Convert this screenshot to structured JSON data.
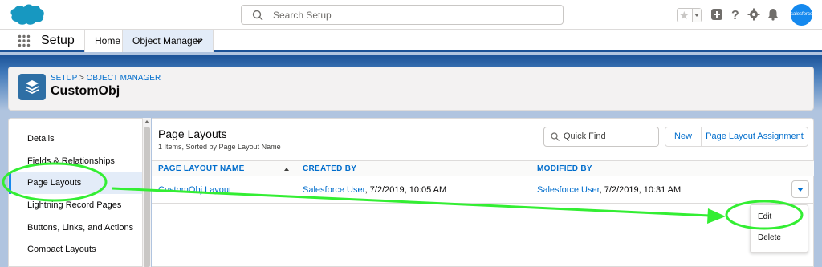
{
  "header": {
    "search_placeholder": "Search Setup",
    "avatar_text": "salesforce"
  },
  "context_nav": {
    "app_name": "Setup",
    "tabs": [
      {
        "label": "Home"
      },
      {
        "label": "Object Manager"
      }
    ]
  },
  "page_header": {
    "breadcrumb": [
      "SETUP",
      "OBJECT MANAGER"
    ],
    "breadcrumb_separator": ">",
    "title": "CustomObj"
  },
  "sidebar": {
    "items": [
      {
        "label": "Details"
      },
      {
        "label": "Fields & Relationships"
      },
      {
        "label": "Page Layouts"
      },
      {
        "label": "Lightning Record Pages"
      },
      {
        "label": "Buttons, Links, and Actions"
      },
      {
        "label": "Compact Layouts"
      }
    ]
  },
  "main": {
    "title": "Page Layouts",
    "subtitle": "1 Items, Sorted by Page Layout Name",
    "quick_find_placeholder": "Quick Find",
    "new_button": "New",
    "assignment_button": "Page Layout Assignment",
    "columns": [
      "PAGE LAYOUT NAME",
      "CREATED BY",
      "MODIFIED BY"
    ],
    "rows": [
      {
        "name": "CustomObj Layout",
        "created_by_user": "Salesforce User",
        "created_date": ", 7/2/2019, 10:05 AM",
        "modified_by_user": "Salesforce User",
        "modified_date": ", 7/2/2019, 10:31 AM"
      }
    ]
  },
  "row_menu": {
    "items": [
      {
        "label": "Edit"
      },
      {
        "label": "Delete"
      }
    ]
  },
  "colors": {
    "brand_blue": "#1b5297",
    "link_blue": "#006dcc",
    "annotation_green": "#33ee33",
    "icon_blue": "#2e6fa5"
  }
}
